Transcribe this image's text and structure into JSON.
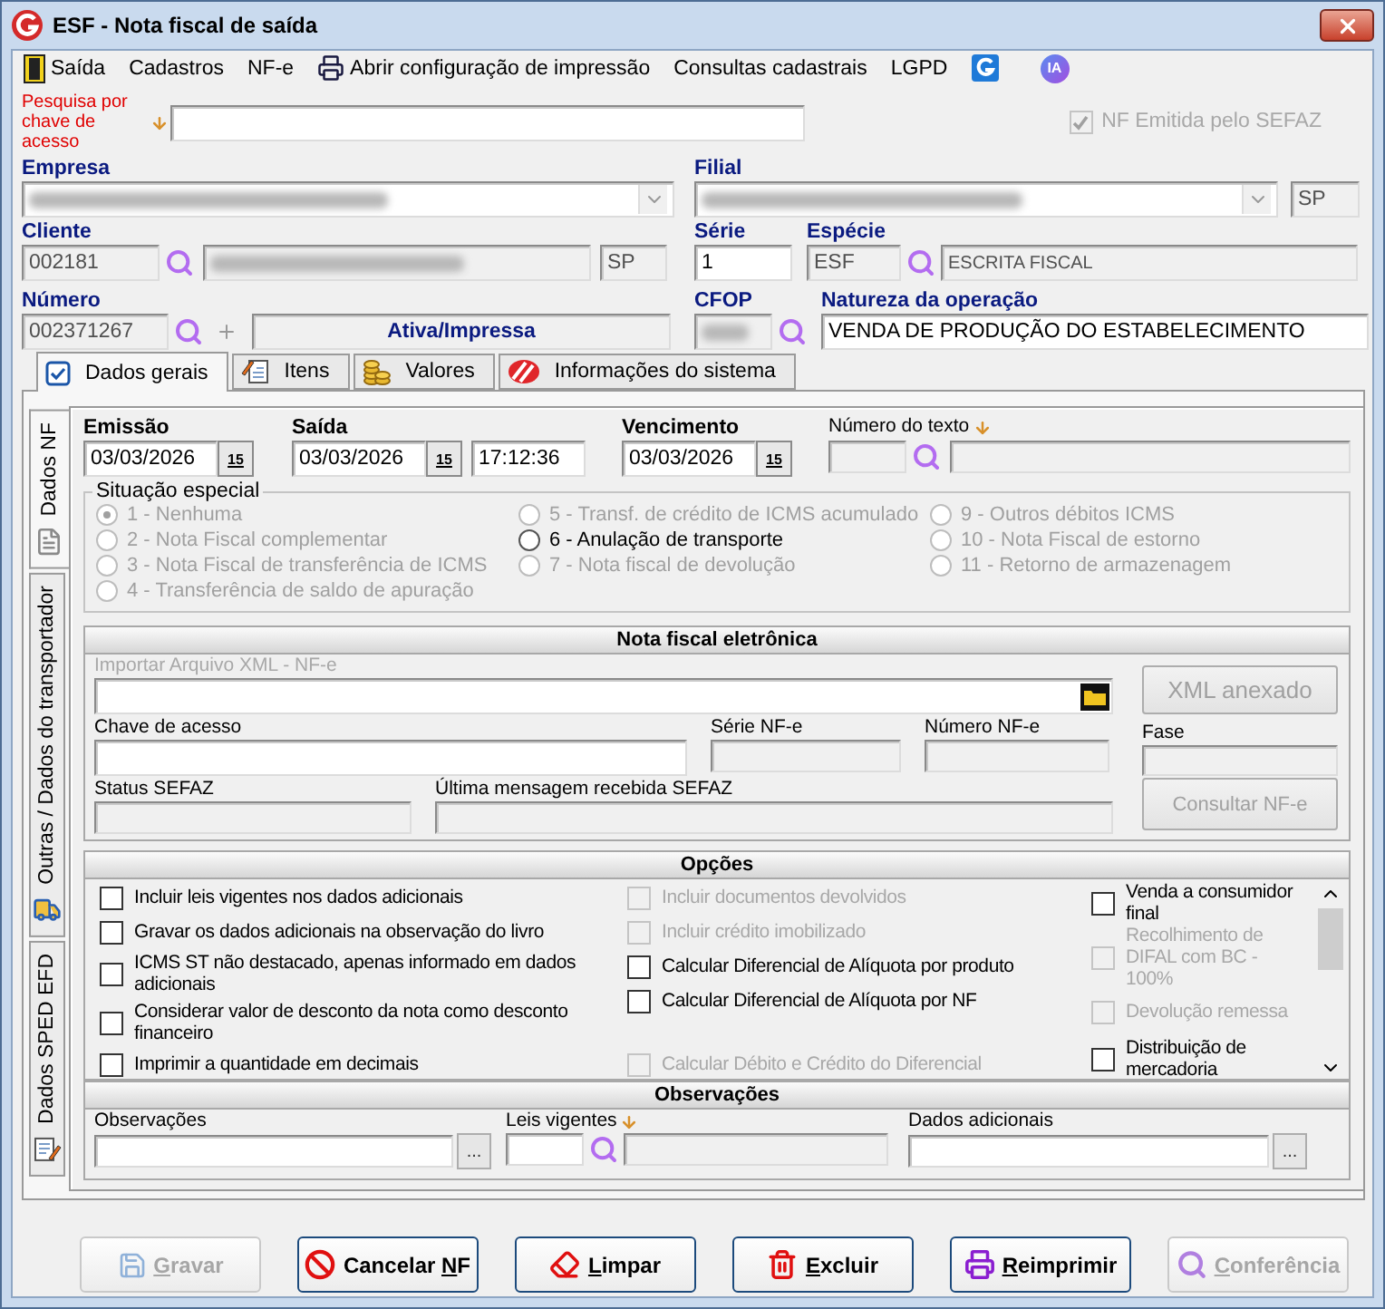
{
  "window": {
    "title": "ESF - Nota fiscal de saída"
  },
  "menu": [
    {
      "kind": "exit",
      "label": "Saída"
    },
    {
      "kind": "text",
      "label": "Cadastros"
    },
    {
      "kind": "text",
      "label": "NF-e"
    },
    {
      "kind": "printer",
      "label": "Abrir configuração de impressão"
    },
    {
      "kind": "text",
      "label": "Consultas cadastrais"
    },
    {
      "kind": "text",
      "label": "LGPD"
    },
    {
      "kind": "app-icon"
    },
    {
      "kind": "badge",
      "label": "IA"
    }
  ],
  "search": {
    "label": "Pesquisa por chave de acesso"
  },
  "nf_emitida": {
    "label": "NF Emitida pelo SEFAZ",
    "checked": true,
    "disabled": true
  },
  "empresa": {
    "label": "Empresa",
    "redacted": true
  },
  "filial": {
    "label": "Filial",
    "redacted": true,
    "uf": "SP"
  },
  "cliente": {
    "label": "Cliente",
    "code": "002181",
    "redacted": true,
    "uf": "SP"
  },
  "serie": {
    "label": "Série",
    "value": "1"
  },
  "especie": {
    "label": "Espécie",
    "code": "ESF",
    "description": "ESCRITA FISCAL"
  },
  "numero": {
    "label": "Número",
    "value": "002371267",
    "status": "Ativa/Impressa"
  },
  "cfop": {
    "label": "CFOP",
    "redacted": true
  },
  "natureza": {
    "label": "Natureza da operação",
    "value": "VENDA DE PRODUÇÃO DO ESTABELECIMENTO"
  },
  "tabs": [
    {
      "label": "Dados gerais",
      "selected": true
    },
    {
      "label": "Itens",
      "selected": false
    },
    {
      "label": "Valores",
      "selected": false
    },
    {
      "label": "Informações do sistema",
      "selected": false
    }
  ],
  "side_tabs": [
    {
      "label": "Dados NF",
      "selected": true
    },
    {
      "label": "Outras / Dados do transportador",
      "selected": false
    },
    {
      "label": "Dados SPED EFD",
      "selected": false
    }
  ],
  "dates": {
    "emissao": {
      "label": "Emissão",
      "value": "03/03/2026",
      "calendar": "15"
    },
    "saida": {
      "label": "Saída",
      "value": "03/03/2026",
      "calendar": "15",
      "time": "17:12:36"
    },
    "vencimento": {
      "label": "Vencimento",
      "value": "03/03/2026",
      "calendar": "15"
    },
    "numero_texto": {
      "label": "Número do texto"
    }
  },
  "situacao": {
    "title": "Situação especial",
    "columns": [
      [
        {
          "label": "1 - Nenhuma",
          "selected": true,
          "disabled": true
        },
        {
          "label": "2 - Nota Fiscal complementar",
          "selected": false,
          "disabled": true
        },
        {
          "label": "3 - Nota Fiscal de transferência de ICMS",
          "selected": false,
          "disabled": true
        },
        {
          "label": "4 - Transferência de saldo de apuração",
          "selected": false,
          "disabled": true
        }
      ],
      [
        {
          "label": "5 - Transf. de crédito de ICMS acumulado",
          "selected": false,
          "disabled": true
        },
        {
          "label": "6 - Anulação de transporte",
          "selected": false,
          "disabled": false
        },
        {
          "label": "7 - Nota fiscal de devolução",
          "selected": false,
          "disabled": true
        }
      ],
      [
        {
          "label": "9 - Outros débitos ICMS",
          "selected": false,
          "disabled": true
        },
        {
          "label": "10 - Nota Fiscal de estorno",
          "selected": false,
          "disabled": true
        },
        {
          "label": "11 - Retorno de armazenagem",
          "selected": false,
          "disabled": true
        }
      ]
    ]
  },
  "nfe": {
    "title": "Nota fiscal eletrônica",
    "import_label": "Importar Arquivo XML - NF-e",
    "xml_button": "XML anexado",
    "chave_label": "Chave de acesso",
    "serie_label": "Série NF-e",
    "numero_label": "Número NF-e",
    "fase_label": "Fase",
    "status_label": "Status SEFAZ",
    "mensagem_label": "Última mensagem recebida SEFAZ",
    "consultar_button": "Consultar NF-e"
  },
  "opcoes": {
    "title": "Opções",
    "columns": [
      [
        {
          "label": "Incluir leis vigentes nos dados adicionais",
          "checked": false,
          "disabled": false
        },
        {
          "label": "Gravar os dados adicionais na observação do livro",
          "checked": false,
          "disabled": false
        },
        {
          "label": "ICMS ST  não destacado, apenas informado em dados adicionais",
          "checked": false,
          "disabled": false
        },
        {
          "label": "Considerar valor de desconto da nota como desconto financeiro",
          "checked": false,
          "disabled": false
        },
        {
          "label": "Imprimir a quantidade em decimais",
          "checked": false,
          "disabled": false
        }
      ],
      [
        {
          "label": "Incluir documentos devolvidos",
          "checked": false,
          "disabled": true
        },
        {
          "label": "Incluir crédito imobilizado",
          "checked": false,
          "disabled": true
        },
        {
          "label": "Calcular Diferencial de Alíquota por produto",
          "checked": false,
          "disabled": false
        },
        {
          "label": "Calcular Diferencial de Alíquota por NF",
          "checked": false,
          "disabled": false
        },
        {
          "label": "Calcular Débito e Crédito do Diferencial",
          "checked": false,
          "disabled": true
        }
      ],
      [
        {
          "label": "Venda a consumidor final",
          "checked": false,
          "disabled": false
        },
        {
          "label": "Recolhimento de DIFAL com BC - 100%",
          "checked": false,
          "disabled": true
        },
        {
          "label": "Devolução remessa",
          "checked": false,
          "disabled": true
        },
        {
          "label": "Distribuição de mercadoria",
          "checked": false,
          "disabled": false
        }
      ]
    ]
  },
  "observacoes": {
    "title": "Observações",
    "observacoes_label": "Observações",
    "observacoes_button": "...",
    "leis_label": "Leis vigentes",
    "dados_label": "Dados adicionais",
    "dados_button": "..."
  },
  "buttons": [
    {
      "key": "G",
      "after": "ravar",
      "disabled": true
    },
    {
      "before": "Cancelar ",
      "key": "N",
      "after": "F",
      "disabled": false
    },
    {
      "key": "L",
      "after": "impar",
      "disabled": false
    },
    {
      "key": "E",
      "after": "xcluir",
      "disabled": false
    },
    {
      "key": "R",
      "after": "eimprimir",
      "disabled": false
    },
    {
      "key": "C",
      "after": "onferência",
      "disabled": true
    }
  ]
}
